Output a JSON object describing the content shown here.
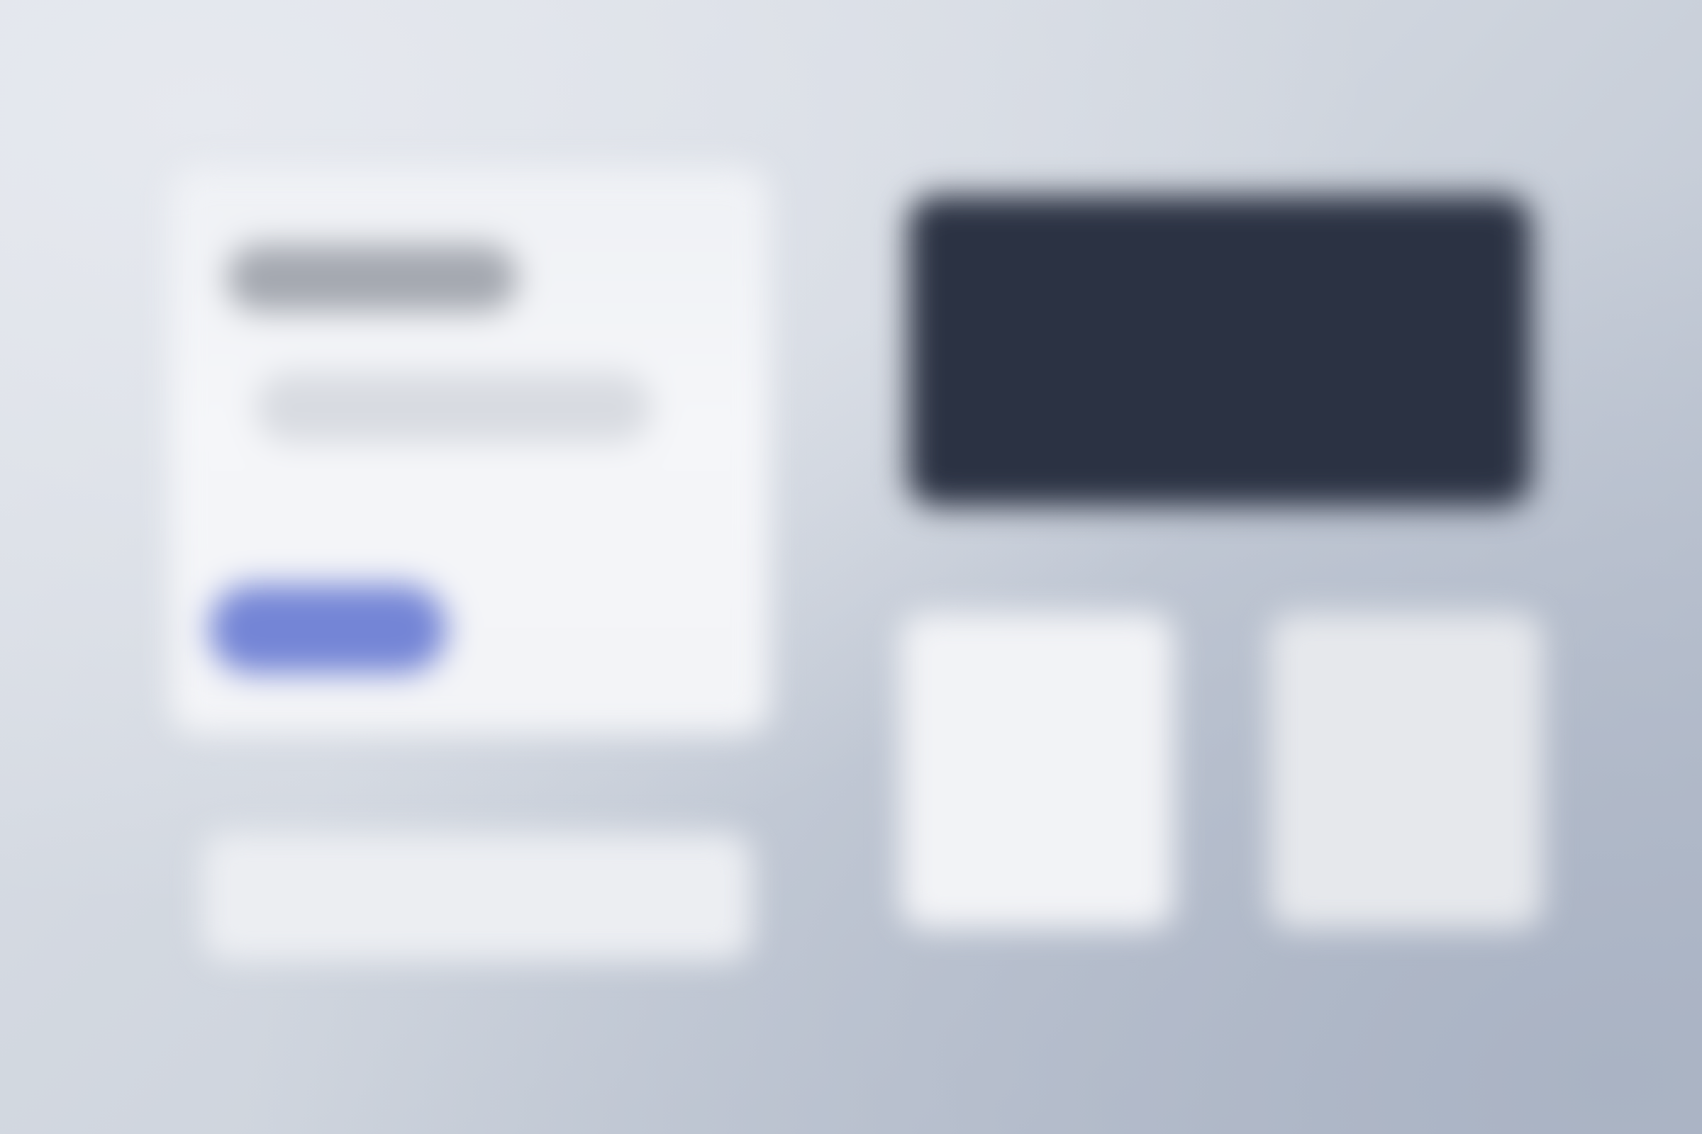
{
  "theme": {
    "background_light": "#dde1e8",
    "background_dark": "#b7bfcd",
    "card_surface": "#f5f6f9",
    "title_placeholder": "#a4a8b0",
    "subtitle_placeholder": "#d8dbe1",
    "accent_button": "#7485d6",
    "dark_panel": "#2b3243",
    "tile_light": "#f2f3f6",
    "tile_muted": "#e6e8ec"
  },
  "left_card": {
    "title_text": "",
    "subtitle_text": "",
    "primary_button_label": ""
  },
  "right_column": {
    "hero_panel_text": ""
  }
}
